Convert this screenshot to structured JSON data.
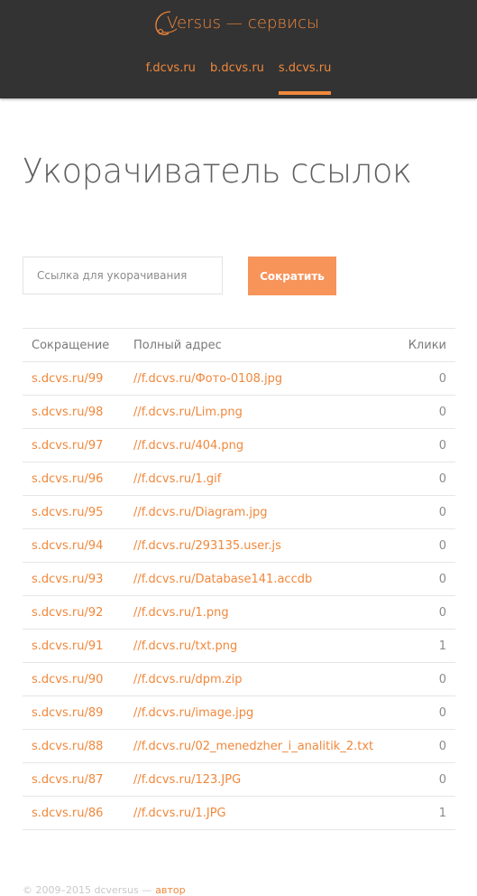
{
  "header": {
    "logo_text": "Versus — сервисы",
    "nav": [
      {
        "label": "f.dcvs.ru",
        "active": false
      },
      {
        "label": "b.dcvs.ru",
        "active": false
      },
      {
        "label": "s.dcvs.ru",
        "active": true
      }
    ]
  },
  "main": {
    "title": "Укорачиватель ссылок",
    "form": {
      "input_placeholder": "Ссылка для укорачивания",
      "input_value": "",
      "submit_label": "Сократить"
    },
    "table": {
      "columns": [
        "Сокращение",
        "Полный адрес",
        "Клики"
      ],
      "rows": [
        {
          "short": "s.dcvs.ru/99",
          "full": "//f.dcvs.ru/Фото-0108.jpg",
          "clicks": "0"
        },
        {
          "short": "s.dcvs.ru/98",
          "full": "//f.dcvs.ru/Lim.png",
          "clicks": "0"
        },
        {
          "short": "s.dcvs.ru/97",
          "full": "//f.dcvs.ru/404.png",
          "clicks": "0"
        },
        {
          "short": "s.dcvs.ru/96",
          "full": "//f.dcvs.ru/1.gif",
          "clicks": "0"
        },
        {
          "short": "s.dcvs.ru/95",
          "full": "//f.dcvs.ru/Diagram.jpg",
          "clicks": "0"
        },
        {
          "short": "s.dcvs.ru/94",
          "full": "//f.dcvs.ru/293135.user.js",
          "clicks": "0"
        },
        {
          "short": "s.dcvs.ru/93",
          "full": "//f.dcvs.ru/Database141.accdb",
          "clicks": "0"
        },
        {
          "short": "s.dcvs.ru/92",
          "full": "//f.dcvs.ru/1.png",
          "clicks": "0"
        },
        {
          "short": "s.dcvs.ru/91",
          "full": "//f.dcvs.ru/txt.png",
          "clicks": "1"
        },
        {
          "short": "s.dcvs.ru/90",
          "full": "//f.dcvs.ru/dpm.zip",
          "clicks": "0"
        },
        {
          "short": "s.dcvs.ru/89",
          "full": "//f.dcvs.ru/image.jpg",
          "clicks": "0"
        },
        {
          "short": "s.dcvs.ru/88",
          "full": "//f.dcvs.ru/02_menedzher_i_analitik_2.txt",
          "clicks": "0"
        },
        {
          "short": "s.dcvs.ru/87",
          "full": "//f.dcvs.ru/123.JPG",
          "clicks": "0"
        },
        {
          "short": "s.dcvs.ru/86",
          "full": "//f.dcvs.ru/1.JPG",
          "clicks": "1"
        }
      ]
    }
  },
  "footer": {
    "copyright": "© 2009–2015 dcversus —",
    "author_link": "автор"
  },
  "colors": {
    "accent": "#f0883c",
    "button": "#f7945a",
    "header_bg": "#333333"
  }
}
